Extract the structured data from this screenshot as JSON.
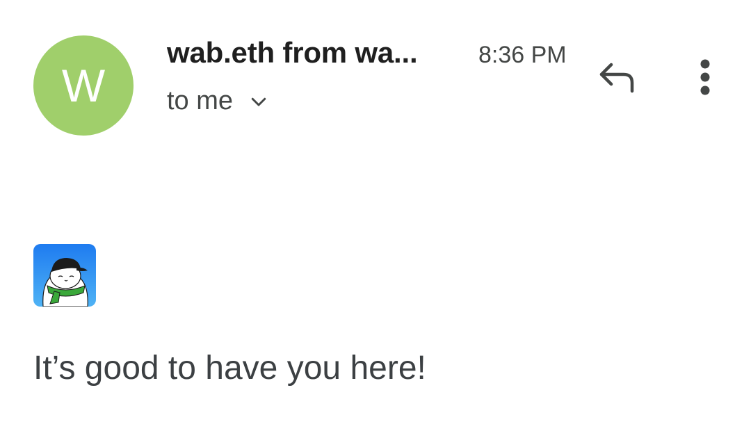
{
  "header": {
    "avatar_letter": "W",
    "avatar_color": "#a0cf6b",
    "sender": "wab.eth from wa...",
    "time": "8:36 PM",
    "recipient": "to me",
    "recipient_expand_icon": "chevron-down-icon",
    "reply_icon": "reply-icon",
    "more_icon": "more-vert-icon"
  },
  "message": {
    "logo_icon": "cat-mascot-logo",
    "text": "It’s good to have you here!"
  }
}
